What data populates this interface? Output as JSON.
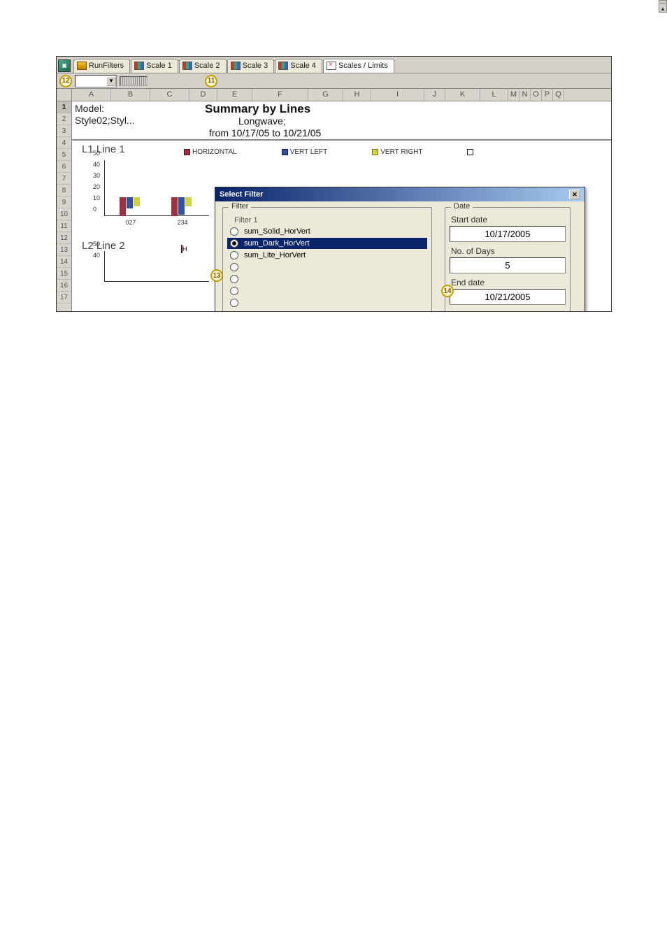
{
  "tabs": [
    {
      "label": "RunFilters",
      "icon": "filter"
    },
    {
      "label": "Scale 1",
      "icon": "chart"
    },
    {
      "label": "Scale 2",
      "icon": "chart"
    },
    {
      "label": "Scale 3",
      "icon": "chart"
    },
    {
      "label": "Scale 4",
      "icon": "chart"
    },
    {
      "label": "Scales / Limits",
      "icon": "limits"
    }
  ],
  "callouts": {
    "tb1": "12",
    "tb2": "11",
    "radio": "13",
    "date": "14"
  },
  "columns": [
    "A",
    "B",
    "C",
    "D",
    "E",
    "F",
    "G",
    "H",
    "I",
    "J",
    "K",
    "L",
    "M",
    "N",
    "O",
    "P",
    "Q"
  ],
  "rows": [
    "1",
    "2",
    "3",
    "4",
    "5",
    "6",
    "7",
    "8",
    "9",
    "10",
    "11",
    "12",
    "13",
    "14",
    "15",
    "16",
    "17"
  ],
  "header": {
    "model_lbl": "Model:",
    "style": "Style02;Styl...",
    "summary": "Summary by Lines",
    "longwave": "Longwave;",
    "range": "from 10/17/05 to 10/21/05"
  },
  "chart1": {
    "title": "L1 Line 1"
  },
  "chart2": {
    "title": "L2 Line 2",
    "legend_prefix": "H"
  },
  "legend": {
    "h": "HORIZONTAL",
    "vl": "VERT LEFT",
    "vr": "VERT RIGHT",
    "blank": ""
  },
  "dialog": {
    "title": "Select Filter",
    "filter_legend": "Filter",
    "filter_sub": "Filter 1",
    "options": [
      {
        "label": "sum_Solid_HorVert",
        "selected": false
      },
      {
        "label": "sum_Dark_HorVert",
        "selected": true
      },
      {
        "label": "sum_Lite_HorVert",
        "selected": false
      },
      {
        "label": "",
        "selected": false
      },
      {
        "label": "",
        "selected": false
      },
      {
        "label": "",
        "selected": false
      },
      {
        "label": "",
        "selected": false
      }
    ],
    "date_legend": "Date",
    "start_lbl": "Start date",
    "start_val": "10/17/2005",
    "days_lbl": "No. of Days",
    "days_val": "5",
    "end_lbl": "End date",
    "end_val": "10/21/2005"
  },
  "chart_data": [
    {
      "type": "bar",
      "title": "L1 Line 1",
      "ylim": [
        0,
        50
      ],
      "yticks": [
        0,
        10,
        20,
        30,
        40,
        50
      ],
      "categories": [
        "027",
        "234"
      ],
      "series": [
        {
          "name": "HORIZONTAL",
          "values": [
            17,
            17
          ]
        },
        {
          "name": "VERT LEFT",
          "values": [
            10,
            16
          ]
        },
        {
          "name": "VERT RIGHT",
          "values": [
            8,
            8
          ]
        }
      ]
    },
    {
      "type": "bar",
      "title": "L2 Line 2",
      "ylim": [
        0,
        50
      ],
      "yticks": [
        40,
        50
      ],
      "categories": [],
      "series": [
        {
          "name": "HORIZONTAL",
          "values": []
        }
      ]
    }
  ]
}
